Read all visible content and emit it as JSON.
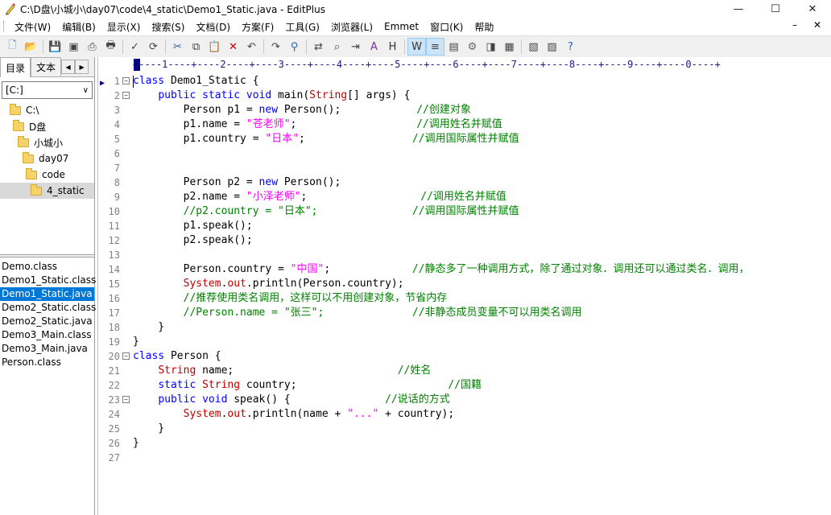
{
  "window": {
    "title": "C:\\D盘\\小城小\\day07\\code\\4_static\\Demo1_Static.java - EditPlus"
  },
  "menu": {
    "items": [
      "文件(W)",
      "编辑(B)",
      "显示(X)",
      "搜索(S)",
      "文档(D)",
      "方案(F)",
      "工具(G)",
      "浏览器(L)",
      "Emmet",
      "窗口(K)",
      "帮助"
    ]
  },
  "sidebar": {
    "tabs": [
      "目录",
      "文本"
    ],
    "drive": "[C:]",
    "folders": [
      "C:\\",
      "D盘",
      "小城小",
      "day07",
      "code",
      "4_static"
    ],
    "files": [
      "Demo.class",
      "Demo1_Static.class",
      "Demo1_Static.java",
      "Demo2_Static.class",
      "Demo2_Static.java",
      "Demo3_Main.class",
      "Demo3_Main.java",
      "Person.class"
    ],
    "selected_file": "Demo1_Static.java"
  },
  "ruler": "+----1----+----2----+----3----+----4----+----5----+----6----+----7----+----8----+----9----+----0----+",
  "editor": {
    "line_numbers": [
      "1",
      "2",
      "3",
      "4",
      "5",
      "6",
      "7",
      "8",
      "9",
      "10",
      "11",
      "12",
      "13",
      "14",
      "15",
      "16",
      "17",
      "18",
      "19",
      "20",
      "21",
      "22",
      "23",
      "24",
      "25",
      "26",
      "27"
    ],
    "lines": [
      [
        [
          "k",
          "class"
        ],
        [
          "n",
          " Demo1_Static {"
        ]
      ],
      [
        [
          "n",
          "    "
        ],
        [
          "k",
          "public static void"
        ],
        [
          "n",
          " main("
        ],
        [
          "t",
          "String"
        ],
        [
          "n",
          "[] args) {"
        ]
      ],
      [
        [
          "n",
          "        Person p1 = "
        ],
        [
          "k",
          "new"
        ],
        [
          "n",
          " Person();            "
        ],
        [
          "c",
          "//创建对象"
        ]
      ],
      [
        [
          "n",
          "        p1.name = "
        ],
        [
          "s",
          "\"苍老师\""
        ],
        [
          "n",
          ";                   "
        ],
        [
          "c",
          "//调用姓名并赋值"
        ]
      ],
      [
        [
          "n",
          "        p1.country = "
        ],
        [
          "s",
          "\"日本\""
        ],
        [
          "n",
          ";                 "
        ],
        [
          "c",
          "//调用国际属性并赋值"
        ]
      ],
      [],
      [],
      [
        [
          "n",
          "        Person p2 = "
        ],
        [
          "k",
          "new"
        ],
        [
          "n",
          " Person();"
        ]
      ],
      [
        [
          "n",
          "        p2.name = "
        ],
        [
          "s",
          "\"小泽老师\""
        ],
        [
          "n",
          ";                  "
        ],
        [
          "c",
          "//调用姓名并赋值"
        ]
      ],
      [
        [
          "c",
          "        //p2.country = \"日本\";               //调用国际属性并赋值"
        ]
      ],
      [
        [
          "n",
          "        p1.speak();"
        ]
      ],
      [
        [
          "n",
          "        p2.speak();"
        ]
      ],
      [],
      [
        [
          "n",
          "        Person.country = "
        ],
        [
          "s",
          "\"中国\""
        ],
        [
          "n",
          ";             "
        ],
        [
          "c",
          "//静态多了一种调用方式，除了通过对象．调用还可以通过类名．调用，"
        ]
      ],
      [
        [
          "n",
          "        "
        ],
        [
          "t",
          "System"
        ],
        [
          "n",
          "."
        ],
        [
          "t",
          "out"
        ],
        [
          "n",
          ".println(Person.country);"
        ]
      ],
      [
        [
          "c",
          "        //推荐使用类名调用，这样可以不用创建对象，节省内存"
        ]
      ],
      [
        [
          "c",
          "        //Person.name = \"张三\";              //非静态成员变量不可以用类名调用"
        ]
      ],
      [
        [
          "n",
          "    }"
        ]
      ],
      [
        [
          "n",
          "}"
        ]
      ],
      [
        [
          "k",
          "class"
        ],
        [
          "n",
          " Person {"
        ]
      ],
      [
        [
          "n",
          "    "
        ],
        [
          "t",
          "String"
        ],
        [
          "n",
          " name;                          "
        ],
        [
          "c",
          "//姓名"
        ]
      ],
      [
        [
          "n",
          "    "
        ],
        [
          "k",
          "static"
        ],
        [
          "n",
          " "
        ],
        [
          "t",
          "String"
        ],
        [
          "n",
          " country;                        "
        ],
        [
          "c",
          "//国籍"
        ]
      ],
      [
        [
          "n",
          "    "
        ],
        [
          "k",
          "public void"
        ],
        [
          "n",
          " speak() {               "
        ],
        [
          "c",
          "//说话的方式"
        ]
      ],
      [
        [
          "n",
          "        "
        ],
        [
          "t",
          "System"
        ],
        [
          "n",
          "."
        ],
        [
          "t",
          "out"
        ],
        [
          "n",
          ".println(name + "
        ],
        [
          "s",
          "\"...\""
        ],
        [
          "n",
          " + country);"
        ]
      ],
      [
        [
          "n",
          "    }"
        ]
      ],
      [
        [
          "n",
          "}"
        ]
      ],
      []
    ]
  },
  "toolbar_icons": [
    "new-file-icon",
    "open-folder-icon",
    "save-icon",
    "save-all-icon",
    "print-preview-icon",
    "print-icon",
    "spellcheck-icon",
    "refresh-icon",
    "cut-icon",
    "copy-icon",
    "paste-icon",
    "delete-icon",
    "undo-icon",
    "redo-icon",
    "find-icon",
    "replace-icon",
    "find-in-files-icon",
    "goto-icon",
    "font-size-icon",
    "heading-icon",
    "word-wrap-icon",
    "line-number-icon",
    "column-select-icon",
    "settings-icon",
    "browser-icon",
    "cliptext-icon",
    "directory-icon",
    "output-icon",
    "help-icon"
  ]
}
